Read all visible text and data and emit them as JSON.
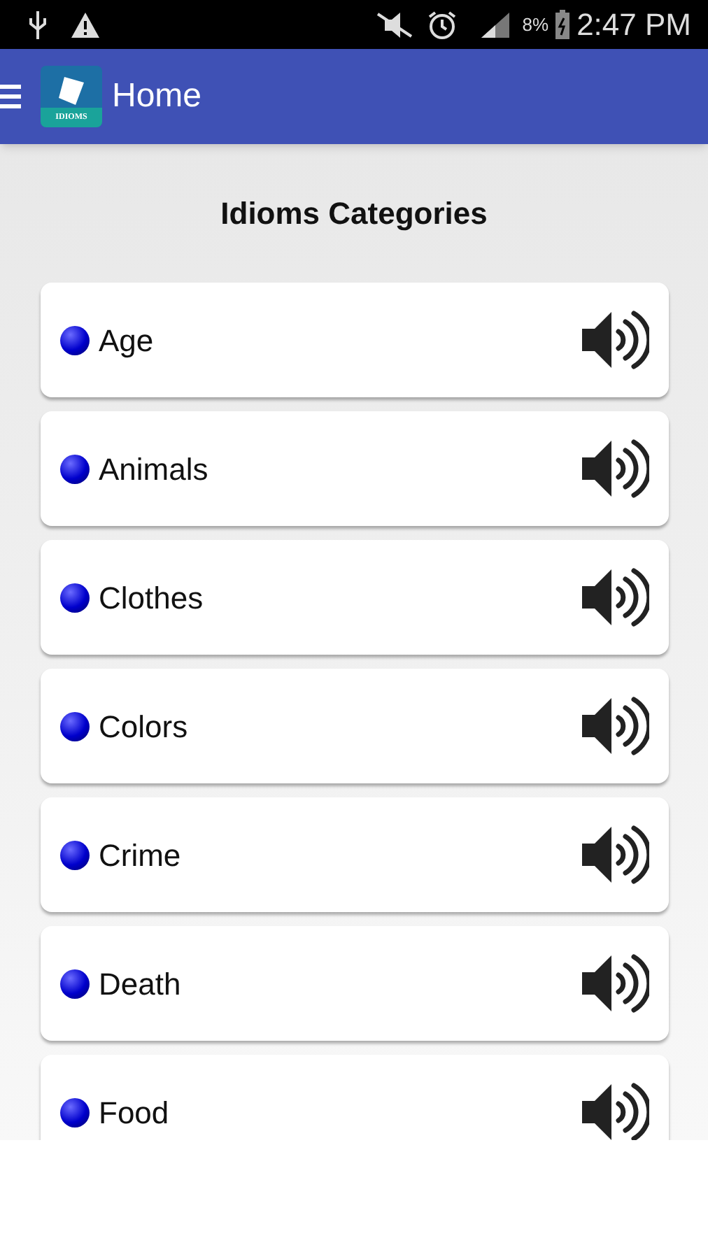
{
  "status_bar": {
    "battery": "8%",
    "time": "2:47 PM"
  },
  "app_bar": {
    "logo_text": "IDIOMS",
    "title": "Home"
  },
  "heading": "Idioms Categories",
  "categories": [
    {
      "label": "Age"
    },
    {
      "label": "Animals"
    },
    {
      "label": "Clothes"
    },
    {
      "label": "Colors"
    },
    {
      "label": "Crime"
    },
    {
      "label": "Death"
    },
    {
      "label": "Food"
    }
  ]
}
